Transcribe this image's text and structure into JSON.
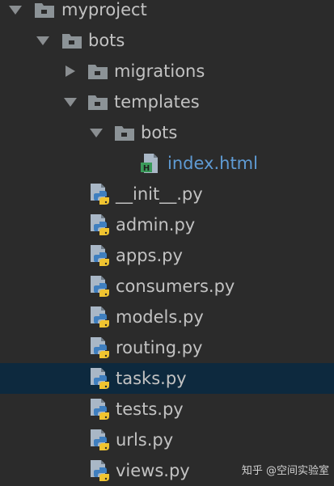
{
  "tree": {
    "rows": [
      {
        "label": "myproject"
      },
      {
        "label": "bots"
      },
      {
        "label": "migrations"
      },
      {
        "label": "templates"
      },
      {
        "label": "bots"
      },
      {
        "label": "index.html"
      },
      {
        "label": "__init__.py"
      },
      {
        "label": "admin.py"
      },
      {
        "label": "apps.py"
      },
      {
        "label": "consumers.py"
      },
      {
        "label": "models.py"
      },
      {
        "label": "routing.py"
      },
      {
        "label": "tasks.py"
      },
      {
        "label": "tests.py"
      },
      {
        "label": "urls.py"
      },
      {
        "label": "views.py"
      }
    ]
  },
  "selected_file": "tasks.py",
  "colors": {
    "background": "#2b2b2b",
    "selection": "#0d293e",
    "text": "#c2c2c2",
    "html_file_text": "#5f9bd4",
    "folder": "#8c9397",
    "python_blue": "#3f7fbf",
    "python_yellow": "#f0c430",
    "html_icon_green": "#3a9a5a"
  },
  "icons": {
    "expanded": "chevron-down-icon",
    "collapsed": "chevron-right-icon",
    "folder": "folder-icon",
    "html_file": "html-file-icon",
    "python_file": "python-file-icon"
  },
  "watermark": "知乎 @空间实验室"
}
